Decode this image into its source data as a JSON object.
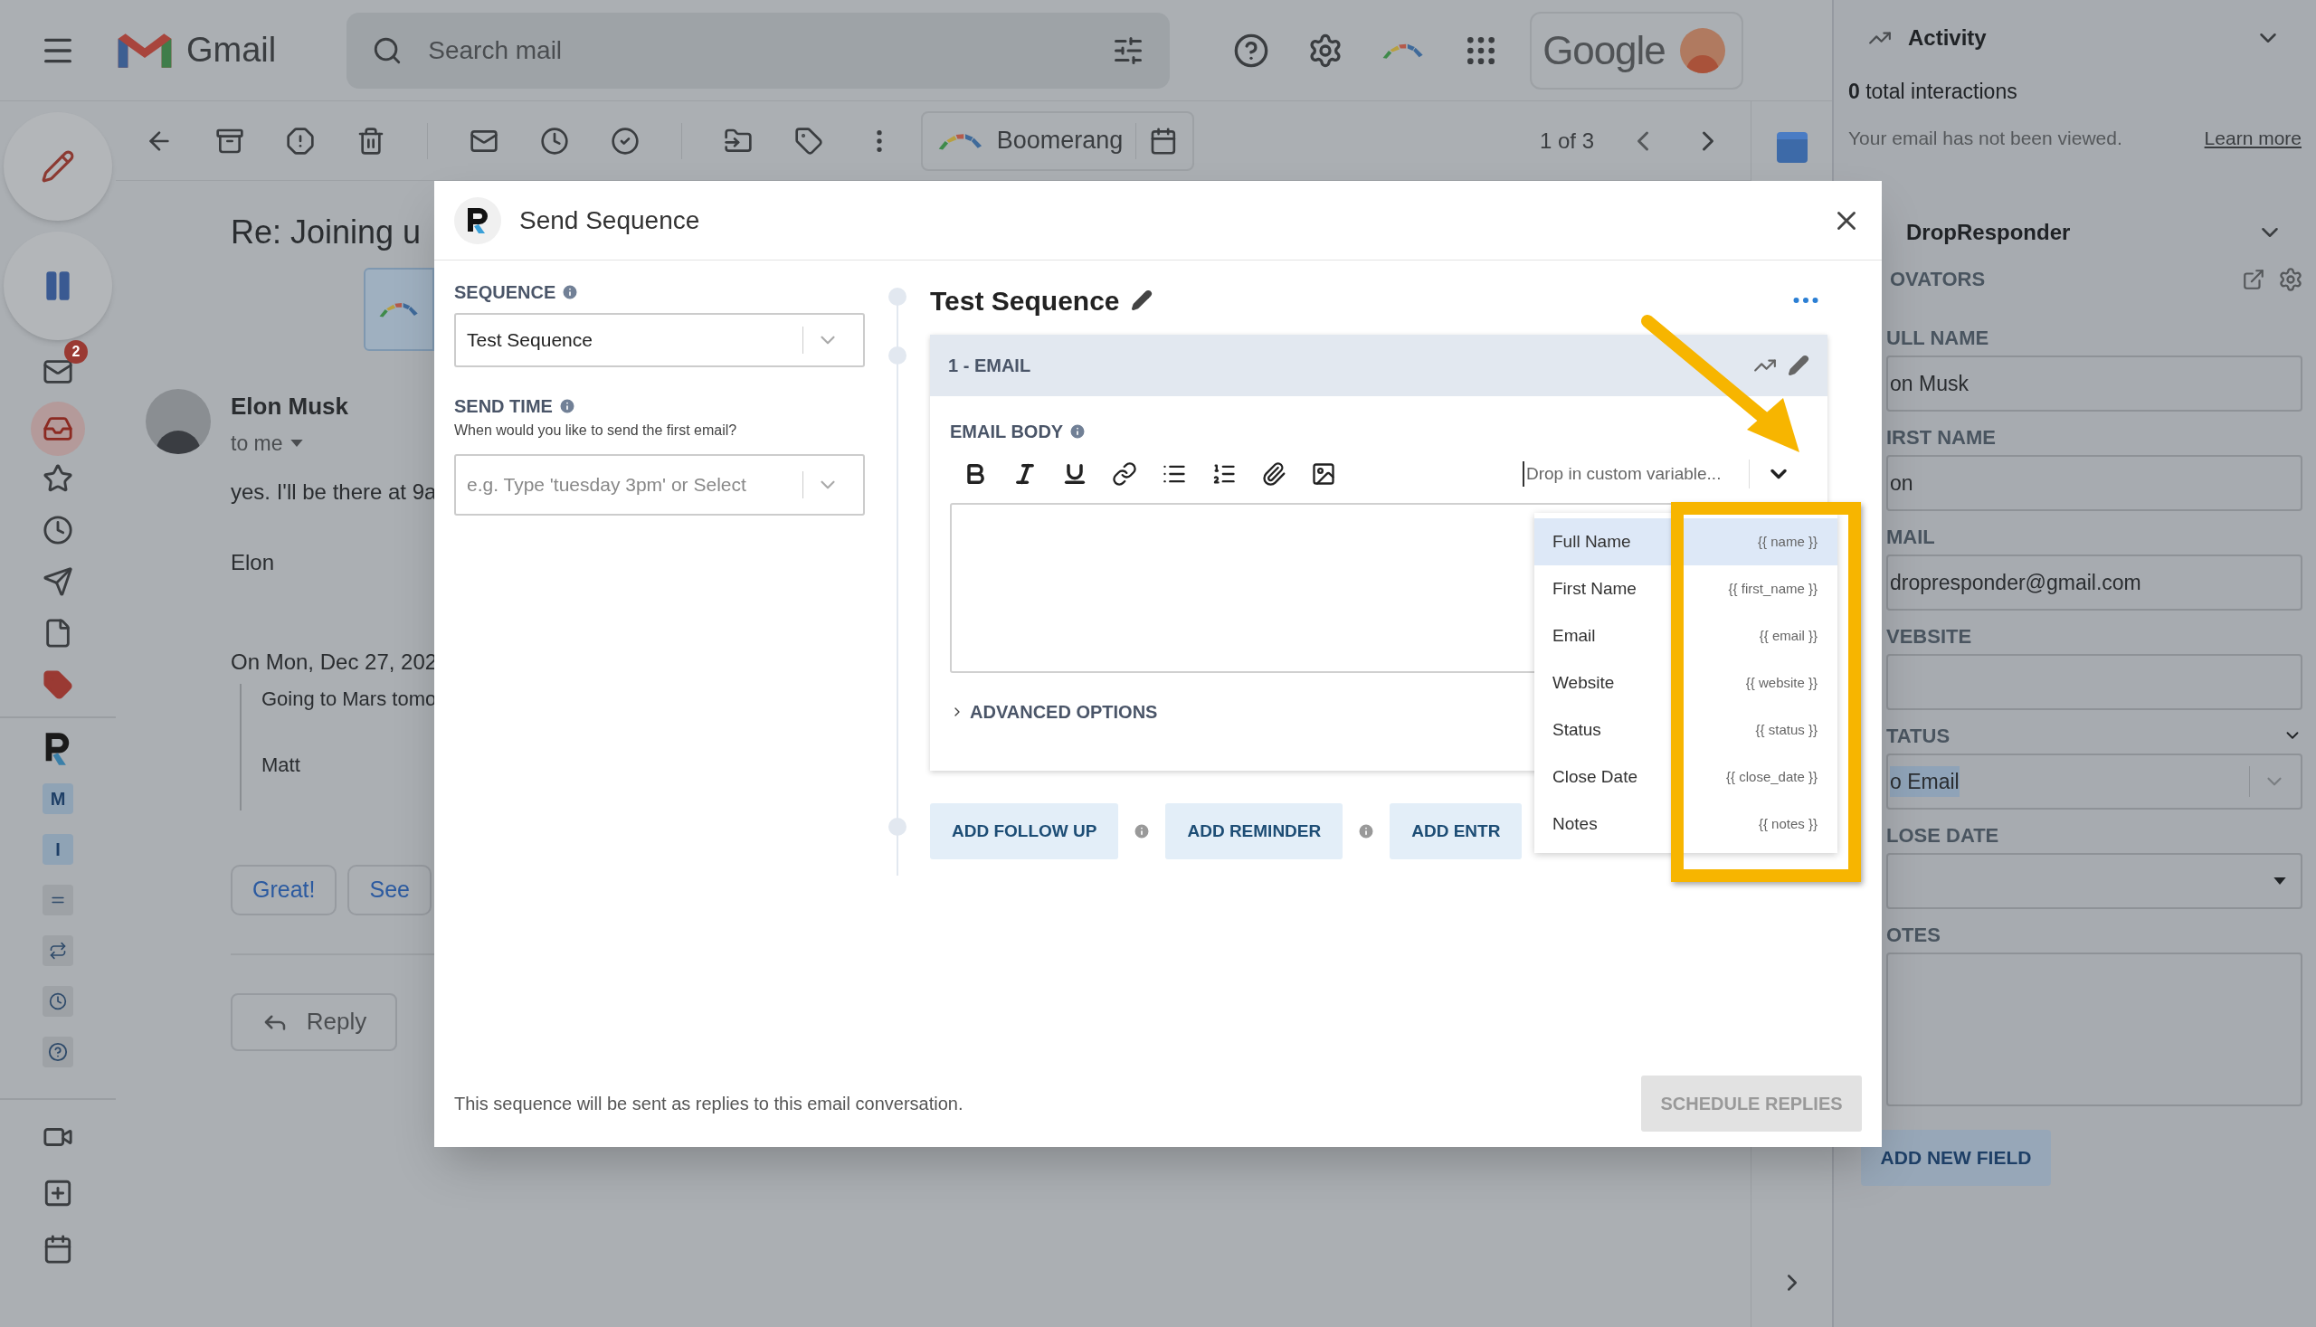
{
  "top_bar": {
    "app_name": "Gmail",
    "search_placeholder": "Search mail",
    "account_text": "Google"
  },
  "left_rail": {
    "mail_badge": "2",
    "addon_badges": [
      "M",
      "I"
    ]
  },
  "toolbar": {
    "boomerang_label": "Boomerang",
    "pager": "1 of 3"
  },
  "email": {
    "subject": "Re: Joining u",
    "sender": "Elon Musk",
    "recipient": "to me",
    "body_lines": [
      "yes. I'll be there at 9a",
      "Elon"
    ],
    "quote_header": "On Mon, Dec 27, 202",
    "quote_lines": [
      "Going to Mars tomo",
      "Matt"
    ],
    "smart_replies": [
      "Great!",
      "See"
    ],
    "reply_button": "Reply"
  },
  "modal": {
    "title": "Send Sequence",
    "sequence_label": "SEQUENCE",
    "sequence_value": "Test Sequence",
    "send_time_label": "SEND TIME",
    "send_time_hint": "When would you like to send the first email?",
    "send_time_placeholder": "e.g. Type 'tuesday 3pm' or Select",
    "sequence_title": "Test Sequence",
    "step_title": "1 - EMAIL",
    "email_body_label": "EMAIL BODY",
    "variable_placeholder": "Drop in custom variable...",
    "advanced_options": "ADVANCED OPTIONS",
    "actions": [
      "ADD FOLLOW UP",
      "ADD REMINDER",
      "ADD ENTR"
    ],
    "variables": [
      {
        "label": "Full Name",
        "token": "{{ name }}",
        "selected": true
      },
      {
        "label": "First Name",
        "token": "{{ first_name }}",
        "selected": false
      },
      {
        "label": "Email",
        "token": "{{ email }}",
        "selected": false
      },
      {
        "label": "Website",
        "token": "{{ website }}",
        "selected": false
      },
      {
        "label": "Status",
        "token": "{{ status }}",
        "selected": false
      },
      {
        "label": "Close Date",
        "token": "{{ close_date }}",
        "selected": false
      },
      {
        "label": "Notes",
        "token": "{{ notes }}",
        "selected": false
      }
    ],
    "footer_note": "This sequence will be sent as replies to this email conversation.",
    "schedule_button": {
      "label": "SCHEDULE REPLIES",
      "disabled": true
    }
  },
  "sidebar": {
    "activity": {
      "title": "Activity",
      "interactions": "**0** total interactions",
      "status": "Your email has not been viewed.",
      "link": "Learn more"
    },
    "dropresponder": {
      "title": "DropResponder",
      "list_name": "OVATORS",
      "fields": [
        {
          "label": "ULL NAME",
          "value": "on Musk",
          "kind": "text"
        },
        {
          "label": "IRST NAME",
          "value": "on",
          "kind": "text"
        },
        {
          "label": "MAIL",
          "value": "dropresponder@gmail.com",
          "kind": "text"
        },
        {
          "label": "VEBSITE",
          "kind": "text"
        },
        {
          "label": "TATUS",
          "value": "o Email",
          "kind": "select"
        },
        {
          "label": "LOSE DATE",
          "kind": "date"
        },
        {
          "label": "OTES",
          "kind": "textarea"
        }
      ],
      "add_field_button": "ADD NEW FIELD"
    }
  }
}
